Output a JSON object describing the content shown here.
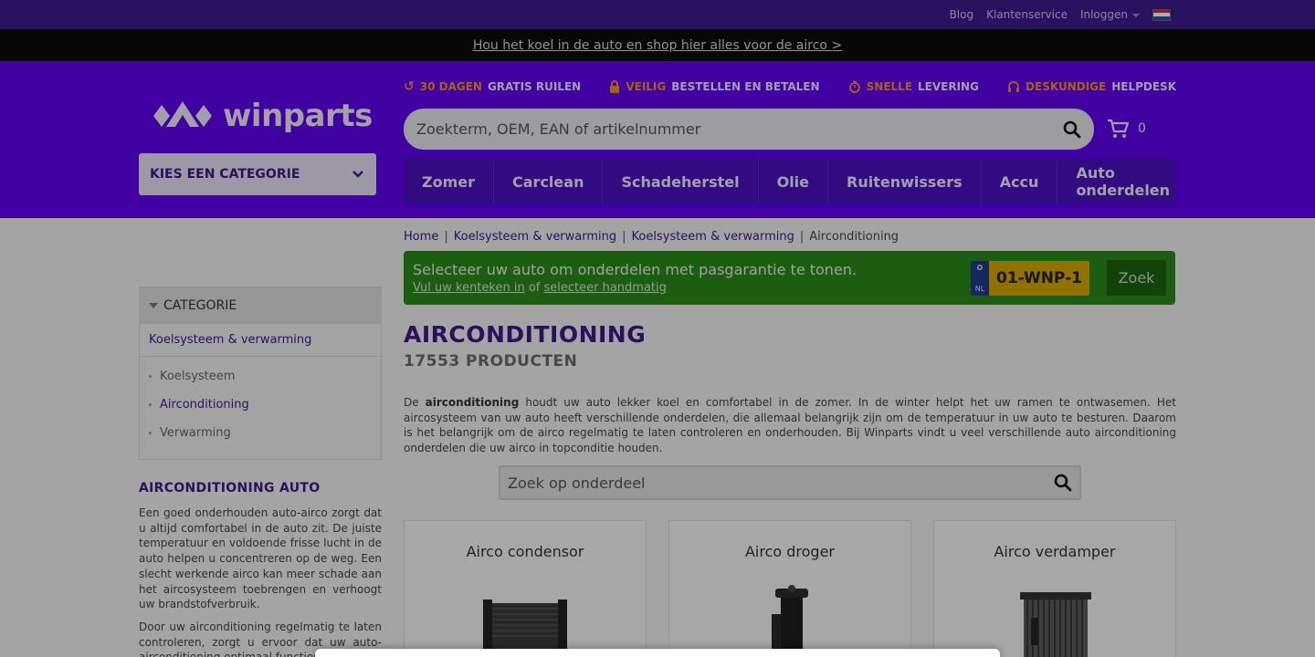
{
  "topbar": {
    "links": [
      "Blog",
      "Klantenservice",
      "Inloggen"
    ],
    "colors": {
      "bg": "#3d1a8c"
    }
  },
  "promo": {
    "text": "Hou het koel in de auto en shop hier alles voor de airco >"
  },
  "header": {
    "logo_text": "winparts",
    "usps": [
      {
        "icon": "return-icon",
        "highlight": "30 DAGEN",
        "rest": "GRATIS RUILEN"
      },
      {
        "icon": "lock-icon",
        "highlight": "VEILIG",
        "rest": "BESTELLEN EN BETALEN"
      },
      {
        "icon": "stopwatch-icon",
        "highlight": "SNELLE",
        "rest": "LEVERING"
      },
      {
        "icon": "headset-icon",
        "highlight": "DESKUNDIGE",
        "rest": "HELPDESK"
      }
    ],
    "search_placeholder": "Zoekterm, OEM, EAN of artikelnummer",
    "cart_count": "0",
    "category_select": "KIES EEN CATEGORIE",
    "nav": [
      "Zomer",
      "Carclean",
      "Schadeherstel",
      "Olie",
      "Ruitenwissers",
      "Accu",
      "Auto onderdelen"
    ],
    "colors": {
      "bg": "#6100ee",
      "accent": "#f7931e"
    }
  },
  "breadcrumb": [
    "Home",
    "Koelsysteem & verwarming",
    "Koelsysteem & verwarming",
    "Airconditioning"
  ],
  "car_selector": {
    "title": "Selecteer uw auto om onderdelen met pasgarantie te tonen.",
    "link1": "Vul uw kenteken in",
    "middle": "of",
    "link2": "selecteer handmatig",
    "plate_country": "NL",
    "plate": "01-WNP-1",
    "button": "Zoek",
    "colors": {
      "bg": "#2a8a1a",
      "plate": "#d6a900"
    }
  },
  "page": {
    "title": "AIRCONDITIONING",
    "count": "17553 PRODUCTEN",
    "intro_pre": "De ",
    "intro_bold": "airconditioning",
    "intro_rest": " houdt uw auto lekker koel en comfortabel in de zomer. In de winter helpt het uw ramen te ontwasemen. Het aircosysteem van uw auto heeft verschillende onderdelen, die allemaal belangrijk zijn om de temperatuur in uw auto te besturen. Daarom is het belangrijk om de airco regelmatig te laten controleren en onderhouden. Bij Winparts vindt u veel verschillende auto airconditioning onderdelen die uw airco in topconditie houden.",
    "part_search_placeholder": "Zoek op onderdeel",
    "cards": [
      "Airco condensor",
      "Airco droger",
      "Airco verdamper"
    ]
  },
  "sidebar": {
    "panel_title": "CATEGORIE",
    "parent": "Koelsysteem & verwarming",
    "items": [
      "Koelsysteem",
      "Airconditioning",
      "Verwarming"
    ],
    "active_item": "Airconditioning",
    "heading": "AIRCONDITIONING AUTO",
    "para1": "Een goed onderhouden auto-airco zorgt dat u altijd comfortabel in de auto zit. De juiste temperatuur en voldoende frisse lucht in de auto helpen u concentreren op de weg. Een slecht werkende airco kan meer schade aan het aircosysteem toebrengen en verhoogt uw brandstofverbruik.",
    "para2": "Door uw airconditioning regelmatig te laten controleren, zorgt u ervoor dat uw auto-airconditioning optimaal functioneert."
  }
}
